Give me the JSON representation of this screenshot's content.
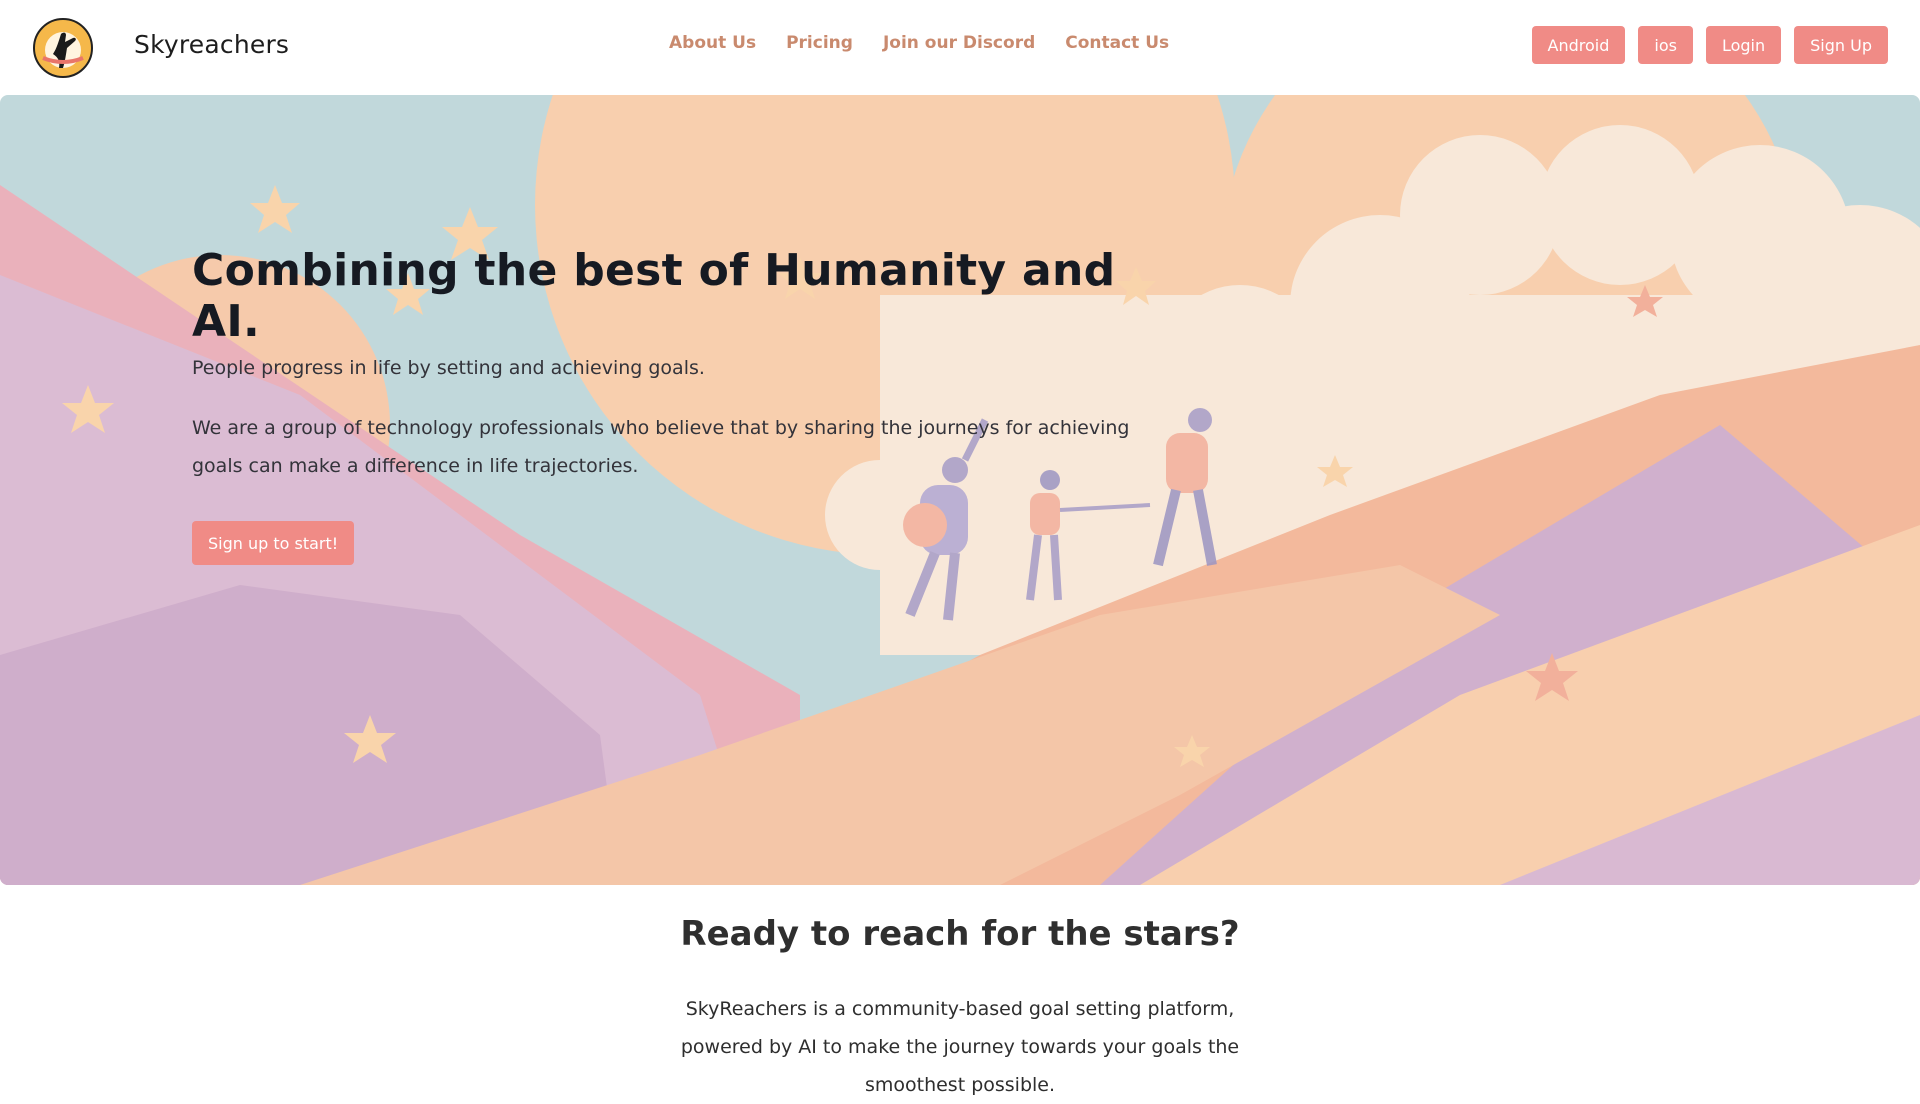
{
  "header": {
    "brand": "Skyreachers",
    "logo_icon": "hand-sun-logo-icon",
    "nav": [
      "About Us",
      "Pricing",
      "Join our Discord",
      "Contact Us"
    ],
    "buttons": [
      "Android",
      "ios",
      "Login",
      "Sign Up"
    ]
  },
  "hero": {
    "title": "Combining the best of Humanity and AI.",
    "subtitle": "People progress in life by setting and achieving goals.",
    "description": "We are a group of technology professionals who believe that by sharing the journeys for achieving goals can make a difference in life trajectories.",
    "cta": "Sign up to start!"
  },
  "section": {
    "title": "Ready to reach for the stars?",
    "text": "SkyReachers is a community-based goal setting platform, powered by AI to make the journey towards your goals the smoothest possible."
  },
  "colors": {
    "accent": "#f08b86",
    "nav_text": "#c98a6e",
    "sky": "#b7d3d8",
    "peach": "#f7c9a3",
    "lavender": "#d7b3cd"
  }
}
